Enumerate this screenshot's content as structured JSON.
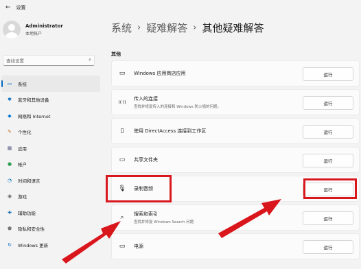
{
  "titlebar": {
    "back": "←",
    "title": "设置"
  },
  "user": {
    "name": "Administrator",
    "account_type": "本地帐户"
  },
  "search": {
    "placeholder": "查找设置",
    "icon": "⌕"
  },
  "nav": [
    {
      "label": "系统",
      "icon": "system-icon",
      "glyph": "▭",
      "color": "#0067c0",
      "active": true
    },
    {
      "label": "蓝牙和其他设备",
      "icon": "bluetooth-icon",
      "glyph": "✱",
      "color": "#0067c0"
    },
    {
      "label": "网络和 Internet",
      "icon": "wifi-icon",
      "glyph": "◆",
      "color": "#0078d4"
    },
    {
      "label": "个性化",
      "icon": "brush-icon",
      "glyph": "✎",
      "color": "#c06a1a"
    },
    {
      "label": "应用",
      "icon": "apps-icon",
      "glyph": "▦",
      "color": "#5b5b8a"
    },
    {
      "label": "帐户",
      "icon": "account-icon",
      "glyph": "●",
      "color": "#2f9e55"
    },
    {
      "label": "时间和语言",
      "icon": "clock-globe-icon",
      "glyph": "◔",
      "color": "#0a7ac0"
    },
    {
      "label": "游戏",
      "icon": "gamepad-icon",
      "glyph": "◉",
      "color": "#666666"
    },
    {
      "label": "辅助功能",
      "icon": "accessibility-icon",
      "glyph": "✚",
      "color": "#1a6fb5"
    },
    {
      "label": "隐私和安全性",
      "icon": "shield-icon",
      "glyph": "⬟",
      "color": "#777777"
    },
    {
      "label": "Windows 更新",
      "icon": "windows-update-icon",
      "glyph": "↻",
      "color": "#0067c0"
    }
  ],
  "breadcrumb": {
    "level1": "系统",
    "level2": "疑难解答",
    "current": "其他疑难解答",
    "separator": "›"
  },
  "section_label": "其他",
  "rows": [
    {
      "title": "Windows 应用商店应用",
      "desc": "",
      "icon": "store-app-icon",
      "glyph": "▭",
      "button": "运行"
    },
    {
      "title": "传入的连接",
      "desc": "查找并修复传入的连接和 Windows 防火墙的问题。",
      "icon": "incoming-connection-icon",
      "glyph": "((·))",
      "button": "运行"
    },
    {
      "title": "使用 DirectAccess 连接到工作区",
      "desc": "",
      "icon": "phone-icon",
      "glyph": "▯",
      "button": "运行"
    },
    {
      "title": "共享文件夹",
      "desc": "",
      "icon": "shared-folder-icon",
      "glyph": "▭",
      "button": "运行"
    },
    {
      "title": "录制音频",
      "desc": "",
      "icon": "microphone-icon",
      "glyph": "🎙",
      "button": "运行"
    },
    {
      "title": "搜索和索引",
      "desc": "查找并修复 Windows Search 问题",
      "icon": "search-icon",
      "glyph": "⌕",
      "button": "运行"
    },
    {
      "title": "电源",
      "desc": "",
      "icon": "battery-icon",
      "glyph": "▭",
      "button": "运行"
    }
  ],
  "annotation_color": "#d9161c"
}
